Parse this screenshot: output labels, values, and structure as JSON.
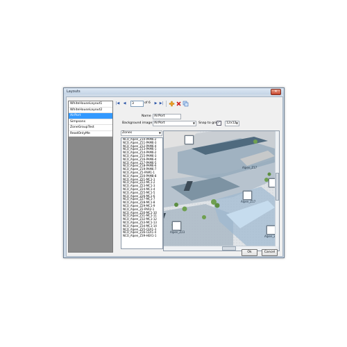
{
  "window": {
    "title": "Layouts",
    "close_glyph": "✕"
  },
  "layouts": [
    {
      "label": "WhiteHouseLayout1",
      "selected": false
    },
    {
      "label": "WhiteHouseLayout2",
      "selected": false
    },
    {
      "label": "AirPort",
      "selected": true
    },
    {
      "label": "Simpsons",
      "selected": false
    },
    {
      "label": "ZoneGroupTest",
      "selected": false
    },
    {
      "label": "ReadOnlyMe",
      "selected": false
    }
  ],
  "toolbar": {
    "first": "|◀",
    "prev": "◀",
    "page": "3",
    "of_label": "of 6",
    "next": "▶",
    "last": "▶|",
    "icons": [
      "add-icon",
      "delete-icon",
      "copy-icon"
    ]
  },
  "form": {
    "name_label": "Name",
    "name_value": "AirPort",
    "background_label": "Background image",
    "background_value": "AirPort",
    "snap_label": "Snap to grid",
    "snap_checked": true,
    "grid_value": "12x12"
  },
  "zones_combo": "Zones",
  "zones": [
    "NCO_Alpen_Z10-PAM6-2",
    "NCO_Alpen_Z11-PAM6-3",
    "NCO_Alpen_Z12-PAM6-4",
    "NCO_Alpen_Z13-PAM6-1",
    "NCO_Alpen_Z14-PAM6-2",
    "NCO_Alpen_Z15-PAM6-3",
    "NCO_Alpen_Z16-PAM6-4",
    "NCO_Alpen_Z17-PAM6-5",
    "NCO_Alpen_Z18-PAM6-6",
    "NCO_Alpen_Z19-PAM6-7",
    "NCO_Alpen_Z1-PAM1-1",
    "NCO_Alpen_Z20-PAM8-8",
    "NCO_Alpen_Z21-MC1-1",
    "NCO_Alpen_Z22-MC1-2",
    "NCO_Alpen_Z23-MC1-3",
    "NCO_Alpen_Z24-MC1-4",
    "NCO_Alpen_Z25-MC1-5",
    "NCO_Alpen_Z26-MC1-6",
    "NCO_Alpen_Z27-MC1-7",
    "NCO_Alpen_Z28-MC1-8",
    "NCO_Alpen_Z29-MC1-9",
    "NCO_Alpen_Z2-PAR2-1",
    "NCO_Alpen_Z30-MC1-10",
    "NCO_Alpen_Z31-MC1-11",
    "NCO_Alpen_Z32-MC1-12",
    "NCO_Alpen_Z33-MC1-13",
    "NCO_Alpen_Z34-MC1-14",
    "NCO_Alpen_Z35-CEX1-3",
    "NCO_Alpen_Z36-CEX1-4",
    "NCO_Alpen_Z39-HEX1-1"
  ],
  "map_pins": [
    {
      "label": "Alpen_Z17"
    },
    {
      "label": "Alpen_Z23"
    },
    {
      "label": "Alpen_Z"
    }
  ],
  "buttons": {
    "ok": "Ok",
    "cancel": "Cancel"
  }
}
